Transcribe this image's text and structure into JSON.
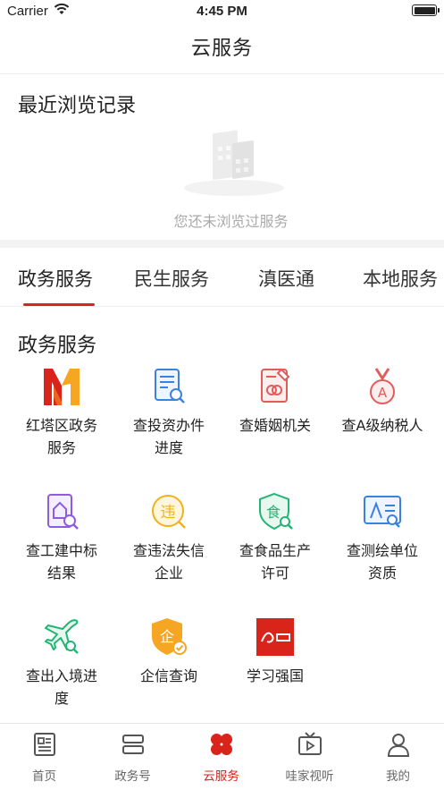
{
  "status_bar": {
    "carrier": "Carrier",
    "time": "4:45 PM"
  },
  "nav": {
    "title": "云服务"
  },
  "recent": {
    "title": "最近浏览记录",
    "empty_text": "您还未浏览过服务"
  },
  "tabs": [
    {
      "label": "政务服务",
      "active": true
    },
    {
      "label": "民生服务",
      "active": false
    },
    {
      "label": "滇医通",
      "active": false
    },
    {
      "label": "本地服务",
      "active": false
    }
  ],
  "section": {
    "title": "政务服务"
  },
  "services": [
    {
      "line1": "红塔区政务",
      "line2": "服务",
      "icon": "hongta-logo-icon"
    },
    {
      "line1": "查投资办件",
      "line2": "进度",
      "icon": "document-search-icon"
    },
    {
      "line1": "查婚姻机关",
      "line2": "",
      "icon": "marriage-certificate-icon"
    },
    {
      "line1": "查A级纳税人",
      "line2": "",
      "icon": "medal-a-icon"
    },
    {
      "line1": "查工建中标",
      "line2": "结果",
      "icon": "construction-bid-icon"
    },
    {
      "line1": "查违法失信",
      "line2": "企业",
      "icon": "violation-search-icon"
    },
    {
      "line1": "查食品生产",
      "line2": "许可",
      "icon": "food-license-icon"
    },
    {
      "line1": "查测绘单位",
      "line2": "资质",
      "icon": "survey-qualification-icon"
    },
    {
      "line1": "查出入境进",
      "line2": "度",
      "icon": "airplane-search-icon"
    },
    {
      "line1": "企信查询",
      "line2": "",
      "icon": "enterprise-shield-icon"
    },
    {
      "line1": "学习强国",
      "line2": "",
      "icon": "xuexi-qiangguo-logo-icon"
    }
  ],
  "tabbar": [
    {
      "label": "首页",
      "icon": "news-icon",
      "active": false
    },
    {
      "label": "政务号",
      "icon": "stack-icon",
      "active": false
    },
    {
      "label": "云服务",
      "icon": "clover-icon",
      "active": true
    },
    {
      "label": "哇家视听",
      "icon": "tv-play-icon",
      "active": false
    },
    {
      "label": "我的",
      "icon": "person-icon",
      "active": false
    }
  ],
  "colors": {
    "accent": "#d9241b",
    "muted_text": "#aaaaaa",
    "divider": "#f3f3f3"
  }
}
